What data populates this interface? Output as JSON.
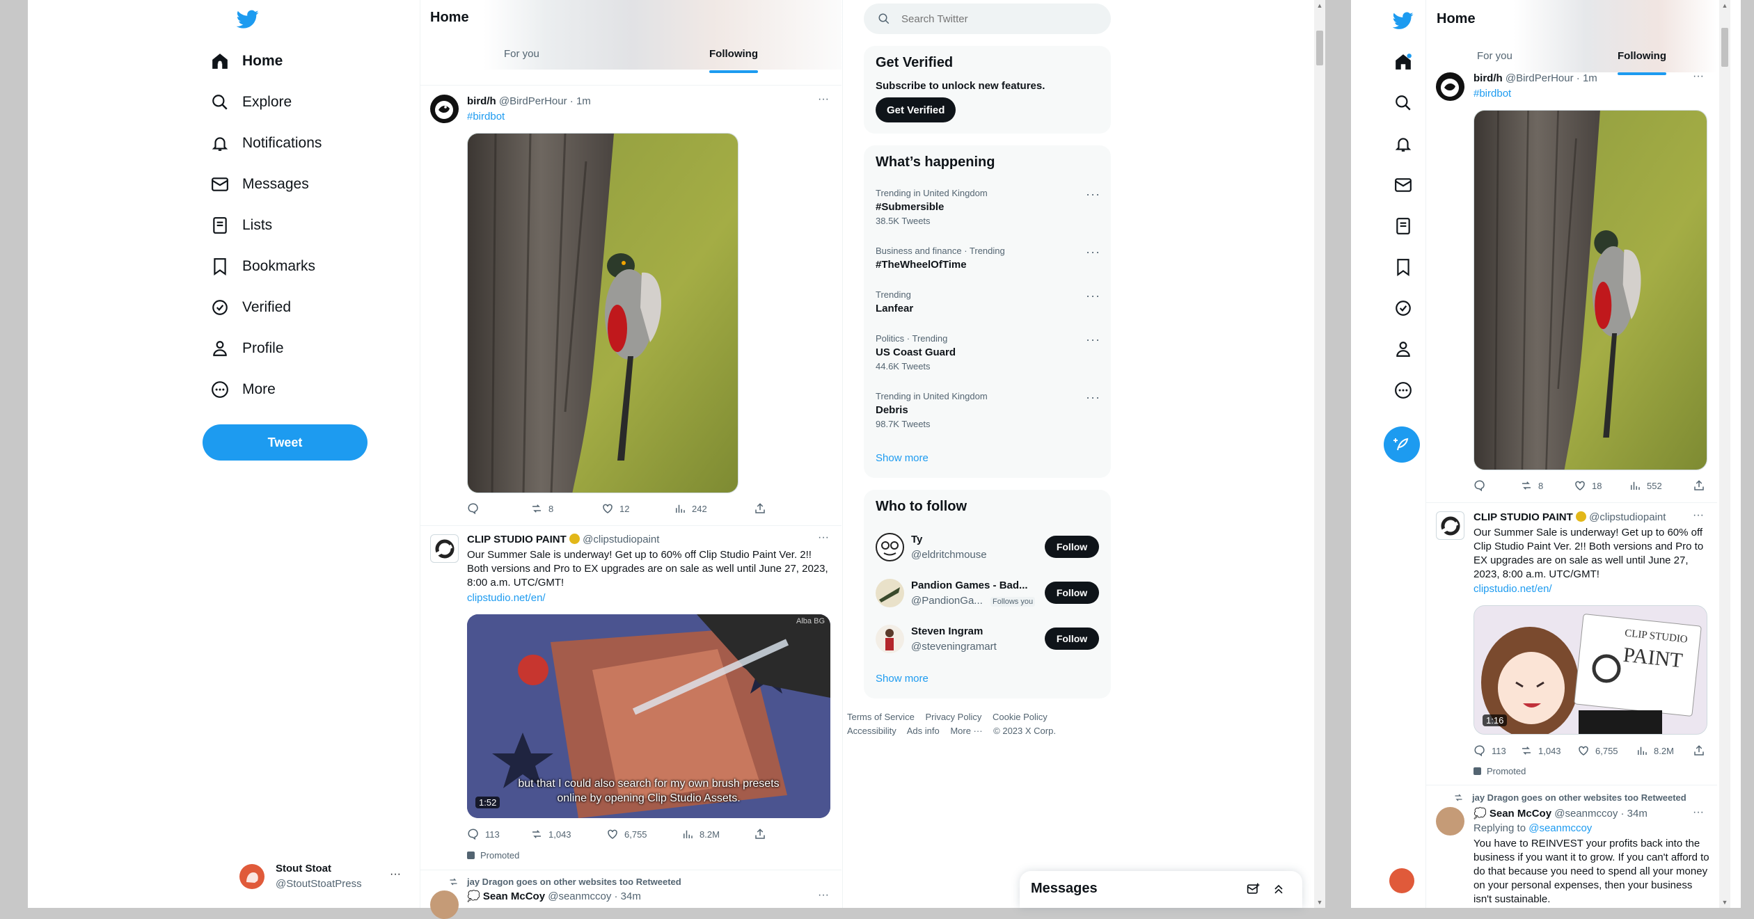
{
  "header": {
    "title": "Home"
  },
  "tabs": [
    {
      "label": "For you"
    },
    {
      "label": "Following"
    }
  ],
  "search": {
    "placeholder": "Search Twitter"
  },
  "nav": [
    {
      "label": "Home",
      "icon": "home-icon"
    },
    {
      "label": "Explore",
      "icon": "search-icon"
    },
    {
      "label": "Notifications",
      "icon": "bell-icon"
    },
    {
      "label": "Messages",
      "icon": "envelope-icon"
    },
    {
      "label": "Lists",
      "icon": "list-icon"
    },
    {
      "label": "Bookmarks",
      "icon": "bookmark-icon"
    },
    {
      "label": "Verified",
      "icon": "verified-icon"
    },
    {
      "label": "Profile",
      "icon": "person-icon"
    },
    {
      "label": "More",
      "icon": "more-circle-icon"
    }
  ],
  "tweet_button": "Tweet",
  "account": {
    "name": "Stout Stoat",
    "handle": "@StoutStoatPress"
  },
  "tweets": [
    {
      "name": "bird/h",
      "handle": "@BirdPerHour",
      "time": "· 1m",
      "hashtag": "#birdbot",
      "stats": {
        "reply": "",
        "retweet": "8",
        "like": "12",
        "views": "242"
      }
    },
    {
      "name": "CLIP STUDIO PAINT",
      "handle": "@clipstudiopaint",
      "text": "Our Summer Sale is underway! Get up to 60% off Clip Studio Paint Ver. 2!! Both versions and Pro to EX upgrades are on sale as well until June 27, 2023, 8:00 a.m. UTC/GMT!",
      "link": "clipstudio.net/en/",
      "video": {
        "watermark": "Alba BG",
        "caption": "but that I could also search for my own brush presets online by opening Clip Studio Assets.",
        "duration": "1:52"
      },
      "stats": {
        "reply": "113",
        "retweet": "1,043",
        "like": "6,755",
        "views": "8.2M"
      },
      "promoted": "Promoted"
    },
    {
      "retweeted_by": "jay Dragon goes on other websites too Retweeted",
      "name": "Sean McCoy",
      "handle": "@seanmccoy",
      "time": "· 34m"
    }
  ],
  "get_verified": {
    "title": "Get Verified",
    "subtitle": "Subscribe to unlock new features.",
    "button": "Get Verified"
  },
  "trends": {
    "title": "What’s happening",
    "items": [
      {
        "context": "Trending in United Kingdom",
        "name": "#Submersible",
        "count": "38.5K Tweets"
      },
      {
        "context": "Business and finance · Trending",
        "name": "#TheWheelOfTime",
        "count": ""
      },
      {
        "context": "Trending",
        "name": "Lanfear",
        "count": ""
      },
      {
        "context": "Politics · Trending",
        "name": "US Coast Guard",
        "count": "44.6K Tweets"
      },
      {
        "context": "Trending in United Kingdom",
        "name": "Debris",
        "count": "98.7K Tweets"
      }
    ],
    "show_more": "Show more"
  },
  "who_to_follow": {
    "title": "Who to follow",
    "items": [
      {
        "name": "Ty",
        "handle": "@eldritchmouse",
        "follows_you": "",
        "button": "Follow"
      },
      {
        "name": "Pandion Games - Bad...",
        "handle": "@PandionGa...",
        "follows_you": "Follows you",
        "button": "Follow"
      },
      {
        "name": "Steven Ingram",
        "handle": "@steveningramart",
        "follows_you": "",
        "button": "Follow"
      }
    ],
    "show_more": "Show more"
  },
  "footer": {
    "links": [
      "Terms of Service",
      "Privacy Policy",
      "Cookie Policy"
    ],
    "links2": [
      "Accessibility",
      "Ads info",
      "More ···",
      "© 2023 X Corp."
    ]
  },
  "messages_drawer": {
    "title": "Messages"
  },
  "right_window": {
    "title": "Home",
    "tabs": [
      "For you",
      "Following"
    ],
    "tweet1": {
      "name": "bird/h",
      "handle": "@BirdPerHour",
      "time": "· 1m",
      "hashtag": "#birdbot",
      "stats": {
        "retweet": "8",
        "like": "18",
        "views": "552"
      }
    },
    "tweet2": {
      "name": "CLIP STUDIO PAINT",
      "handle": "@clipstudiopaint",
      "text": "Our Summer Sale is underway! Get up to 60% off Clip Studio Paint Ver. 2!! Both versions and Pro to EX upgrades are on sale as well until June 27, 2023, 8:00 a.m. UTC/GMT!",
      "link": "clipstudio.net/en/",
      "video": {
        "brand1": "CLIP STUDIO",
        "brand2": "PAINT",
        "duration": "1:16"
      },
      "stats": {
        "reply": "113",
        "retweet": "1,043",
        "like": "6,755",
        "views": "8.2M"
      },
      "promoted": "Promoted"
    },
    "tweet3": {
      "retweeted_by": "jay Dragon goes on other websites too Retweeted",
      "name": "Sean McCoy",
      "handle": "@seanmccoy",
      "time": "· 34m",
      "replying": "Replying to",
      "replying_handle": "@seanmccoy",
      "text": "You have to REINVEST your profits back into the business if you want it to grow. If you can't afford to do that because you need to spend all your money on your personal expenses, then your business isn't sustainable."
    }
  },
  "colors": {
    "accent": "#1d9bf0",
    "text": "#0f1419",
    "muted": "#536471",
    "panel": "#f7f9f9"
  }
}
